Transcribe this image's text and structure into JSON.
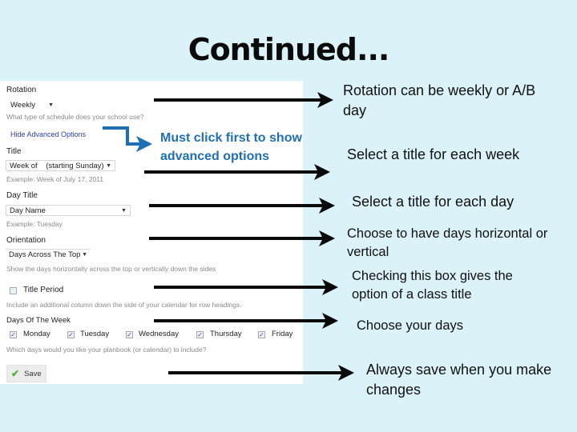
{
  "slide_title": "Continued...",
  "form": {
    "rotation": {
      "label": "Rotation",
      "value": "Weekly",
      "hint": "What type of schedule does your school use?"
    },
    "advanced_link": "Hide Advanced Options",
    "title": {
      "label": "Title",
      "value": "Week of    (starting Sunday)",
      "hint": "Example: Week of July 17, 2011"
    },
    "day_title": {
      "label": "Day Title",
      "value": "Day Name",
      "hint": "Example: Tuesday"
    },
    "orientation": {
      "label": "Orientation",
      "value": "Days Across The Top",
      "hint": "Show the days horizontally across the top or vertically down the sides"
    },
    "title_period": {
      "label": "Title Period",
      "checked": false,
      "hint": "Include an additional column down the side of your calendar for row headings."
    },
    "days_of_week": {
      "label": "Days Of The Week",
      "days": [
        {
          "name": "Monday",
          "checked": true
        },
        {
          "name": "Tuesday",
          "checked": true
        },
        {
          "name": "Wednesday",
          "checked": true
        },
        {
          "name": "Thursday",
          "checked": true
        },
        {
          "name": "Friday",
          "checked": true
        }
      ],
      "hint": "Which days would you like your planbook (or calendar) to include?"
    },
    "save_label": "Save"
  },
  "annotations": {
    "advanced": "Must click first to show advanced options",
    "rotation": "Rotation can be weekly or A/B day",
    "title": "Select a title for each week",
    "day_title": "Select a title for each day",
    "orientation": "Choose to have days horizontal or vertical",
    "title_period": "Checking this box gives the option of a class title",
    "days": "Choose your days",
    "save": "Always save when you make changes"
  },
  "colors": {
    "background": "#daf2f8",
    "annotation_blue": "#1f6fb5",
    "link_blue": "#2a3fb0"
  }
}
